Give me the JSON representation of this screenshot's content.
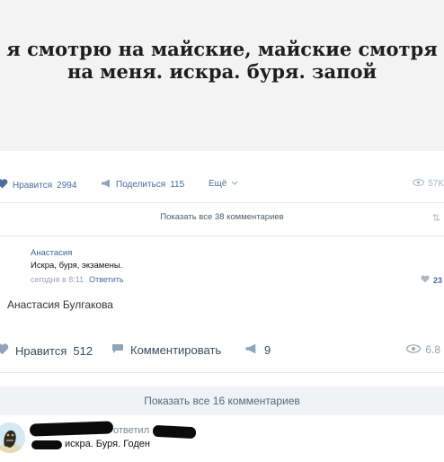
{
  "meme": {
    "line1": "я смотрю на майские, майские смотря",
    "line2": "на меня. искра. буря. запой"
  },
  "post1": {
    "like_label": "Нравится",
    "like_count": "2994",
    "share_label": "Поделиться",
    "share_count": "115",
    "more_label": "Ещё",
    "views": "57K",
    "show_all_comments": "Показать все 38 комментариев",
    "comment": {
      "author": "Анастасия",
      "text": "Искра, буря, экзамены.",
      "time": "сегодня в 8:11",
      "reply_label": "Ответить",
      "likes": "23"
    },
    "repost_author": "Анастасия Булгакова"
  },
  "post2": {
    "like_label": "Нравится",
    "like_count": "512",
    "comment_label": "Комментировать",
    "share_count": "9",
    "views": "6.8"
  },
  "comments2": {
    "show_all": "Показать все 16 комментариев",
    "comment": {
      "answered_label": "ответил",
      "text": "искра. Буря. Годен"
    }
  },
  "colors": {
    "link_blue": "#4a6d9a",
    "meme_bg": "#f3f3f3",
    "show_all_bg": "#f0f2f5"
  },
  "icons": [
    "heart-icon",
    "megaphone-icon",
    "chevron-down-icon",
    "eye-icon",
    "sort-icon",
    "comment-icon"
  ]
}
